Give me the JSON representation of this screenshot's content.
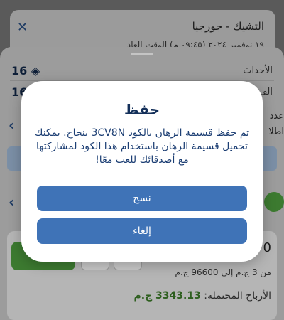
{
  "match_card": {
    "title": "التشيك - جورجيا",
    "datetime": "١٩ نوفمبر ٢٠٢٤ (٠٩:٤٥ م) الوقت العاد"
  },
  "sheet": {
    "events_label": "الأحداث",
    "events_count": "16",
    "row2_label_partial": "الف",
    "row2_value_partial": "16",
    "side_text_1": "عدد",
    "side_text_2": "اطلا"
  },
  "stake": {
    "value_partial": "0",
    "range_text": "من 3 ج.م إلى 96600 ج.م",
    "profit_label": "الأرباح المحتملة:",
    "profit_amount": "3343.13 ج.م"
  },
  "modal": {
    "title": "حفظ",
    "message": "تم حفظ قسيمة الرهان بالكود 3CV8N بنجاح. يمكنك تحميل قسيمة الرهان باستخدام هذا الكود لمشاركتها مع أصدقائك للعب معًا!",
    "copy_label": "نسخ",
    "cancel_label": "إلغاء"
  },
  "colors": {
    "primary_button": "#3f73b7",
    "title_text": "#14305a",
    "message_text": "#1d3f74",
    "profit_green": "#2e5f1f"
  }
}
